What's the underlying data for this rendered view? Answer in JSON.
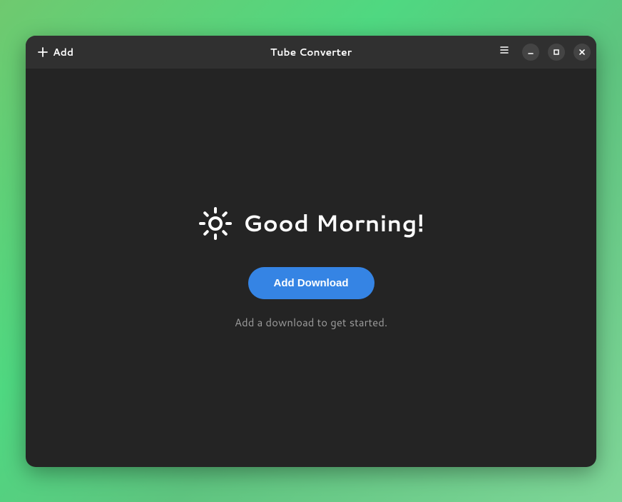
{
  "titlebar": {
    "add_label": "Add",
    "title": "Tube Converter"
  },
  "content": {
    "greeting": "Good Morning!",
    "primary_button": "Add Download",
    "hint": "Add a download to get started."
  }
}
